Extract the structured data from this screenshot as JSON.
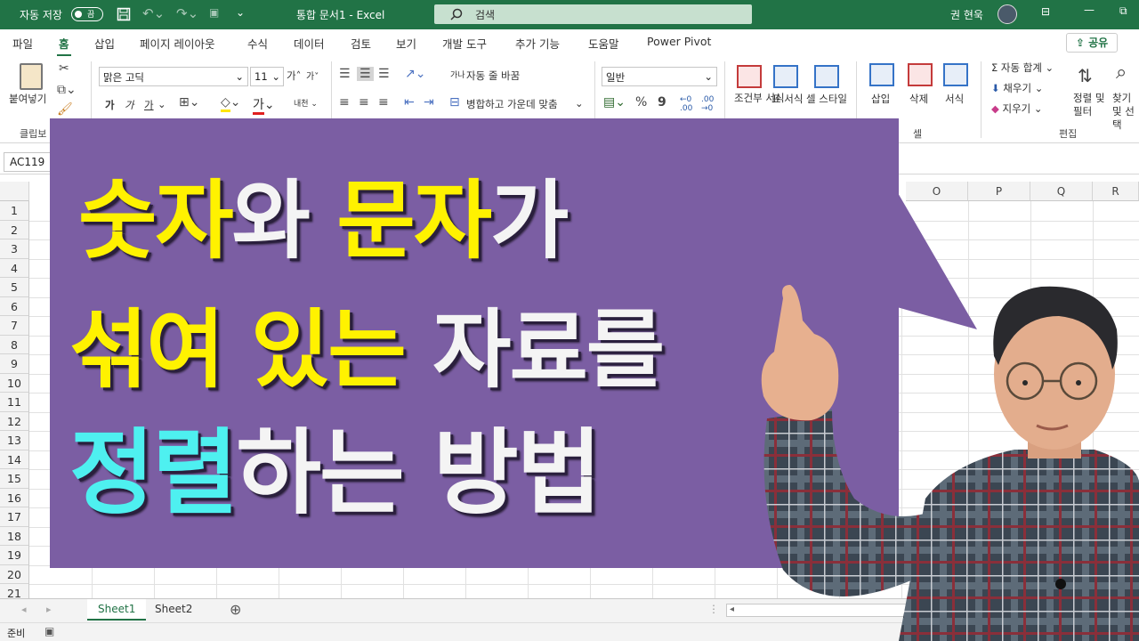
{
  "titlebar": {
    "autosave_label": "자동 저장",
    "autosave_state": "끔",
    "doc_title": "통합 문서1 - Excel",
    "search_placeholder": "검색",
    "user_name": "권 현욱"
  },
  "tabs": [
    "파일",
    "홈",
    "삽입",
    "페이지 레이아웃",
    "수식",
    "데이터",
    "검토",
    "보기",
    "개발 도구",
    "추가 기능",
    "도움말",
    "Power Pivot"
  ],
  "active_tab": "홈",
  "share_label": "공유",
  "ribbon": {
    "clipboard": {
      "paste": "붙여넣기",
      "group": "클립보"
    },
    "font": {
      "name": "맑은 고딕",
      "size": "11",
      "grow": "가",
      "shrink": "가",
      "bold": "가",
      "italic": "가",
      "underline": "가",
      "phonetic": "내천"
    },
    "alignment": {
      "wrap": "자동 줄 바꿈",
      "merge": "병합하고 가운데 맞춤",
      "wrap_icon": "가나"
    },
    "number": {
      "format": "일반",
      "percent": "%",
      "comma": "9"
    },
    "styles": {
      "conditional": "조건부 서식",
      "table": "표 서식",
      "cell": "셀 스타일"
    },
    "cells": {
      "insert": "삽입",
      "delete": "삭제",
      "format": "서식",
      "group": "셀"
    },
    "editing": {
      "autosum": "자동 합계",
      "fill": "채우기",
      "clear": "지우기",
      "sort": "정렬 및 필터",
      "find": "찾기 및 선택",
      "group": "편집"
    }
  },
  "formula_bar": {
    "name_box": "AC119"
  },
  "columns": [
    "O",
    "P",
    "Q",
    "R"
  ],
  "rows": [
    "1",
    "2",
    "3",
    "4",
    "5",
    "6",
    "7",
    "8",
    "9",
    "10",
    "11",
    "12",
    "13",
    "14",
    "15",
    "16",
    "17",
    "18",
    "19",
    "20",
    "21"
  ],
  "sheets": [
    "Sheet1",
    "Sheet2"
  ],
  "active_sheet": "Sheet1",
  "status": {
    "ready": "준비"
  },
  "banner": {
    "line1": [
      {
        "text": "숫자",
        "color": "yellow"
      },
      {
        "text": "와 ",
        "color": "white"
      },
      {
        "text": "문자",
        "color": "yellow"
      },
      {
        "text": "가",
        "color": "white"
      }
    ],
    "line2": [
      {
        "text": "섞여 있는 ",
        "color": "yellow"
      },
      {
        "text": "자료를",
        "color": "white"
      }
    ],
    "line3": [
      {
        "text": "정렬",
        "color": "cyan"
      },
      {
        "text": "하는 방법",
        "color": "white"
      }
    ]
  },
  "colors": {
    "excel_green": "#217346",
    "banner": "#7b5ea3",
    "yellow": "#fff200",
    "cyan": "#4ef0f0"
  }
}
